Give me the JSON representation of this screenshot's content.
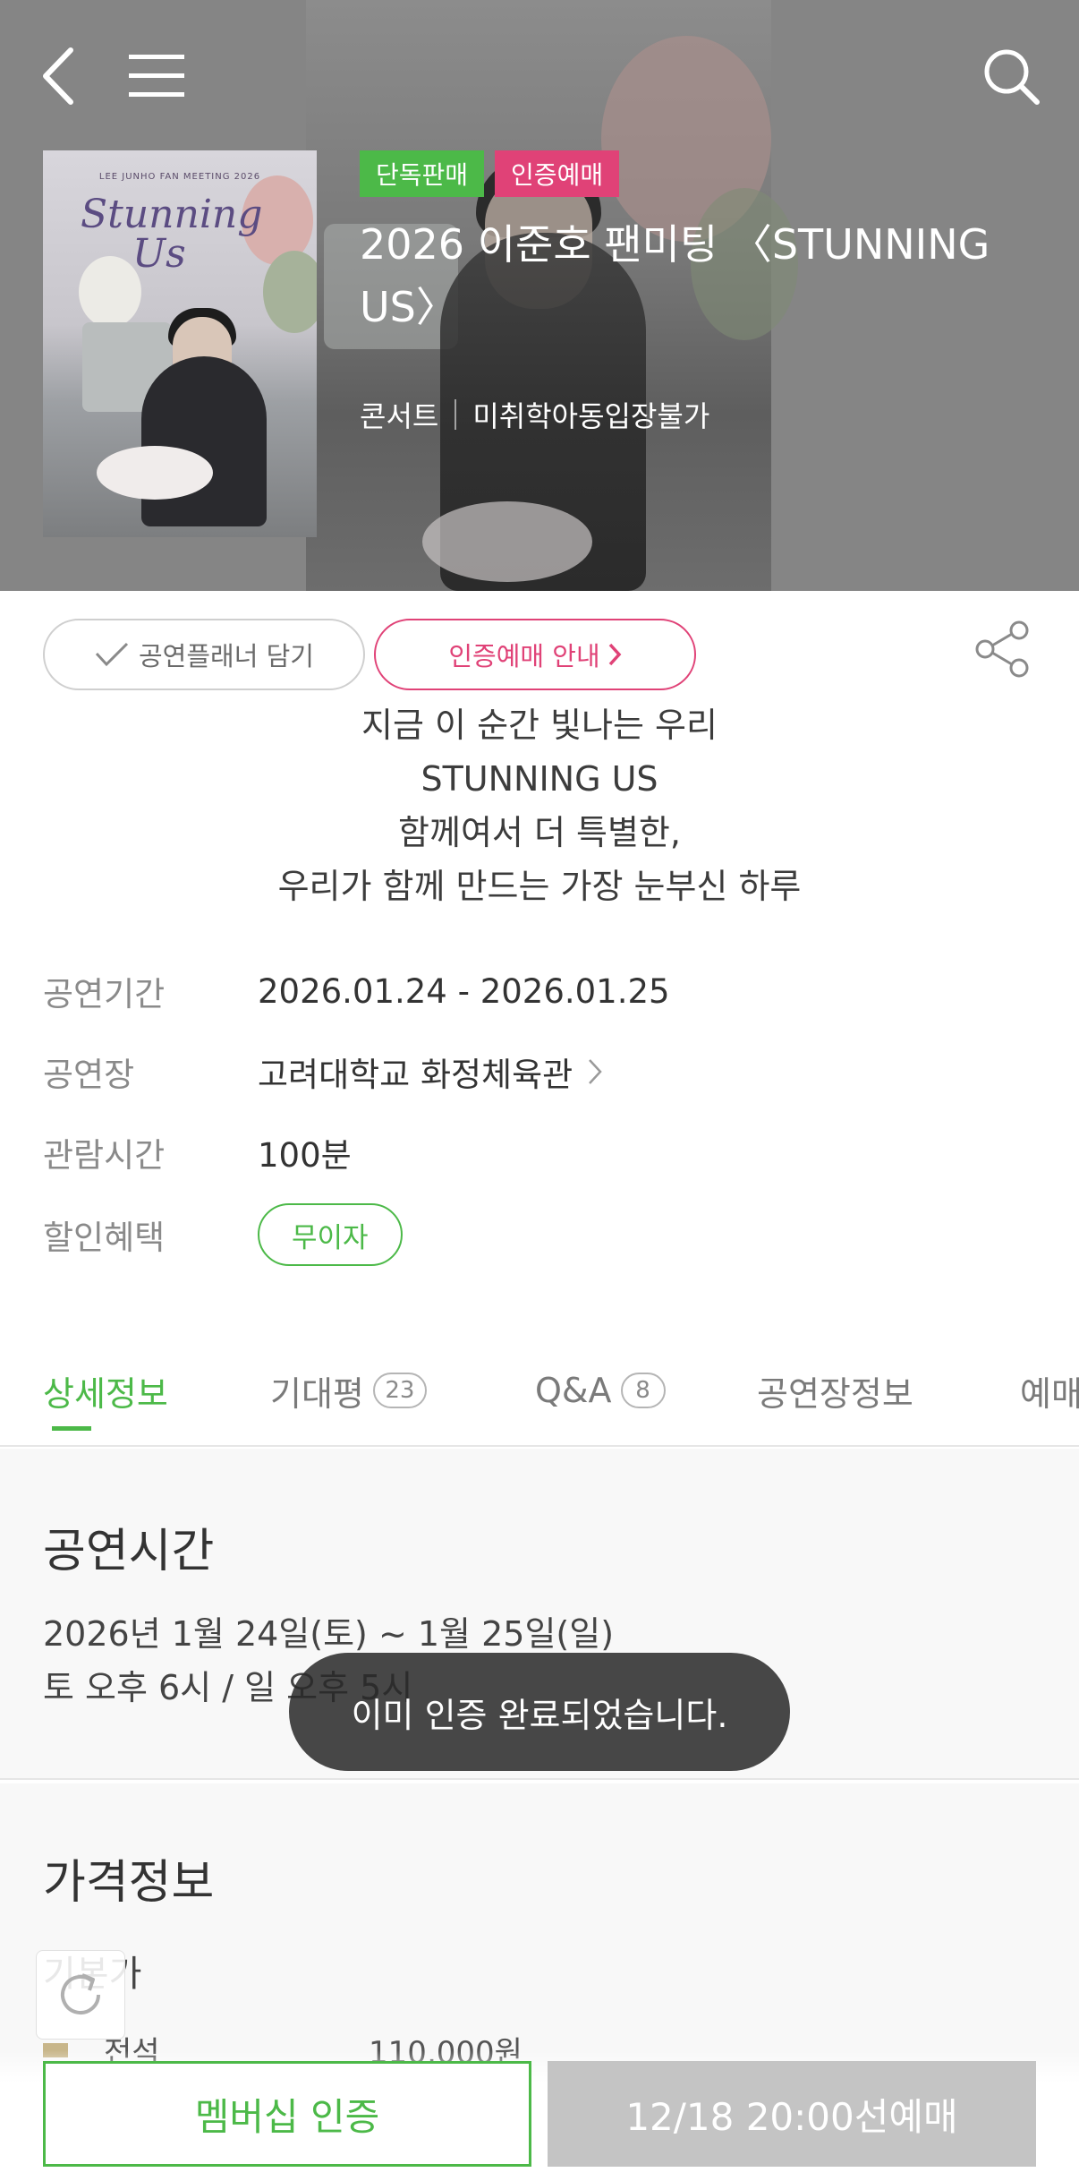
{
  "header": {
    "badges": [
      "단독판매",
      "인증예매"
    ],
    "title": "2026 이준호 팬미팅 〈STUNNING US〉",
    "genre": "콘서트",
    "age_limit": "미취학아동입장불가",
    "poster_text": {
      "subtitle": "LEE JUNHO FAN MEETING 2026",
      "title_line1": "Stunning",
      "title_line2": "Us"
    }
  },
  "actions": {
    "planner": "공연플래너 담기",
    "cert_info": "인증예매 안내"
  },
  "tagline": [
    "지금 이 순간 빛나는 우리",
    "STUNNING US",
    "함께여서 더 특별한,",
    "우리가 함께 만드는 가장 눈부신 하루"
  ],
  "info": {
    "period_label": "공연기간",
    "period_value": "2026.01.24 - 2026.01.25",
    "venue_label": "공연장",
    "venue_value": "고려대학교 화정체육관",
    "runtime_label": "관람시간",
    "runtime_value": "100분",
    "discount_label": "할인혜택",
    "discount_value": "무이자"
  },
  "tabs": [
    {
      "label": "상세정보"
    },
    {
      "label": "기대평",
      "count": "23"
    },
    {
      "label": "Q&A",
      "count": "8"
    },
    {
      "label": "공연장정보"
    },
    {
      "label": "예매"
    }
  ],
  "showtime": {
    "title": "공연시간",
    "line1": "2026년 1월 24일(토) ~ 1월 25일(일)",
    "line2": "토 오후 6시 / 일 오후 5시"
  },
  "price": {
    "title": "가격정보",
    "grade_label": "기본가",
    "rows": [
      {
        "seat": "전석",
        "price": "110,000원"
      }
    ]
  },
  "toast": "이미 인증 완료되었습니다.",
  "bottom": {
    "membership": "멤버십 인증",
    "presale": "12/18 20:00선예매"
  },
  "colors": {
    "accent_green": "#4cb948",
    "accent_pink": "#e04277",
    "hero_bg": "#858585",
    "disabled": "#c4c4c4"
  }
}
